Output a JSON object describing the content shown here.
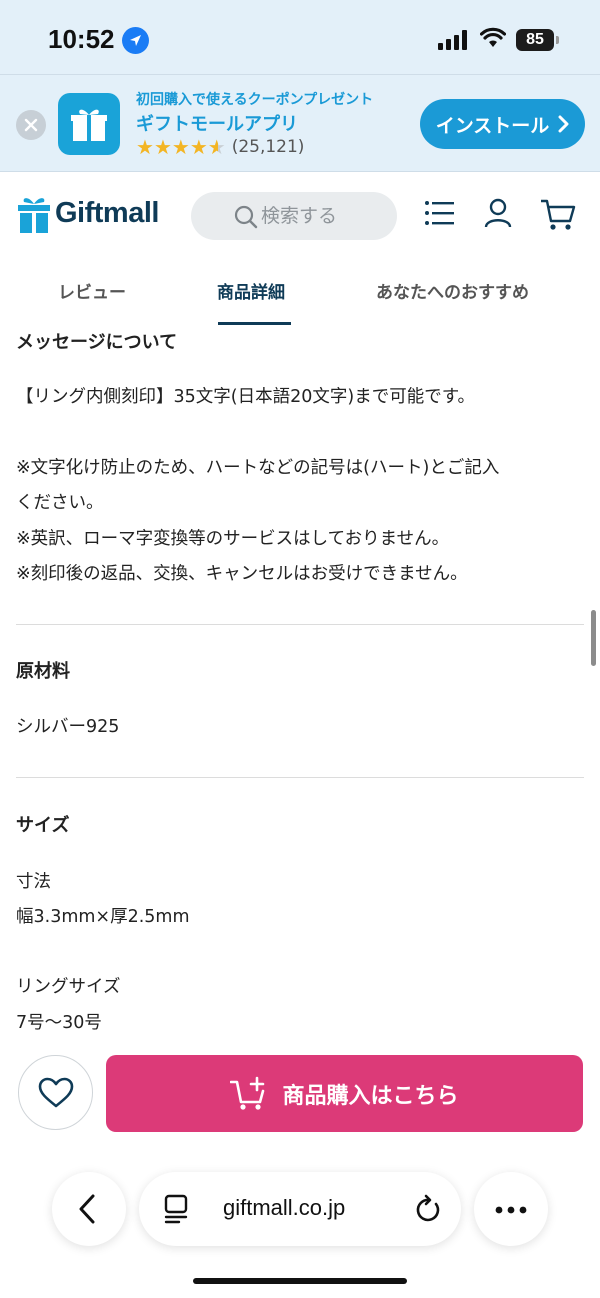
{
  "status_bar": {
    "time": "10:52",
    "battery": "85"
  },
  "app_banner": {
    "tagline": "初回購入で使えるクーポンプレゼント",
    "app_name": "ギフトモールアプリ",
    "rating_count": "(25,121)",
    "stars": 4.5,
    "install_label": "インストール"
  },
  "header": {
    "logo_text": "Giftmall",
    "search_placeholder": "検索する"
  },
  "tabs": [
    {
      "label": "レビュー",
      "active": false
    },
    {
      "label": "商品詳細",
      "active": true
    },
    {
      "label": "あなたへのおすすめ",
      "active": false
    }
  ],
  "sections": {
    "message": {
      "title": "メッセージについて",
      "lines": [
        "【リング内側刻印】35文字(日本語20文字)まで可能です。",
        "※文字化け防止のため、ハートなどの記号は(ハート)とご記入",
        "ください。",
        "※英訳、ローマ字変換等のサービスはしておりません。",
        "※刻印後の返品、交換、キャンセルはお受けできません。"
      ]
    },
    "material": {
      "title": "原材料",
      "value": "シルバー925"
    },
    "size": {
      "title": "サイズ",
      "dimensions_label": "寸法",
      "dimensions_value": "幅3.3mm×厚2.5mm",
      "ring_size_label": "リングサイズ",
      "ring_size_value": "7号〜30号"
    }
  },
  "purchase": {
    "buy_label": "商品購入はこちら"
  },
  "browser": {
    "url": "giftmall.co.jp"
  },
  "colors": {
    "brand_navy": "#0f3b57",
    "brand_blue": "#1b9ad6",
    "buy_pink": "#dc3a78",
    "banner_bg": "#e3f0f9"
  }
}
